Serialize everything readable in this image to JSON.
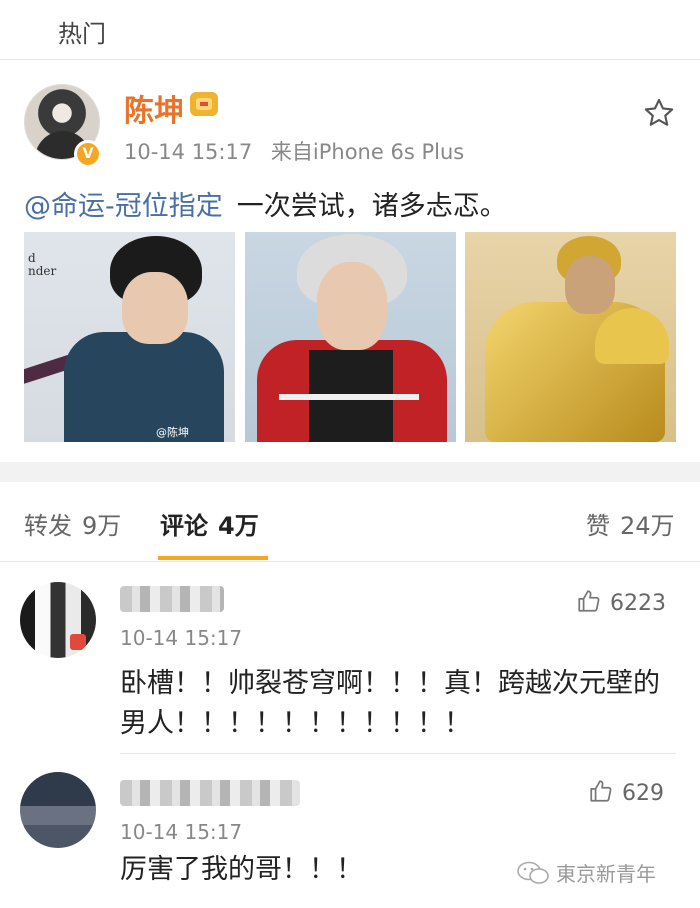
{
  "header": {
    "hot_label": "热门"
  },
  "post": {
    "username": "陈坤",
    "time": "10-14 15:17",
    "source": "来自iPhone 6s Plus",
    "mention": "@命运-冠位指定",
    "text": "一次尝试，诸多忐忑。",
    "photos": [
      {
        "caption_text": "d\nnder",
        "watermark": "@陈坤"
      },
      {},
      {}
    ]
  },
  "tabs": {
    "repost": {
      "label": "转发",
      "count": "9万"
    },
    "comments": {
      "label": "评论",
      "count": "4万"
    },
    "likes": {
      "label": "赞",
      "count": "24万"
    }
  },
  "comments": [
    {
      "time": "10-14 15:17",
      "likes": "6223",
      "text": "卧槽！！帅裂苍穹啊！！！真！跨越次元壁的男人！！！！！！！！！！！"
    },
    {
      "time": "10-14 15:17",
      "likes": "629",
      "text": "厉害了我的哥！！！"
    }
  ],
  "watermark": {
    "text": "東京新青年"
  },
  "colors": {
    "username": "#e8742b",
    "mention": "#4a6fa5",
    "tab_underline": "#f5a623",
    "verified": "#f5a623"
  }
}
